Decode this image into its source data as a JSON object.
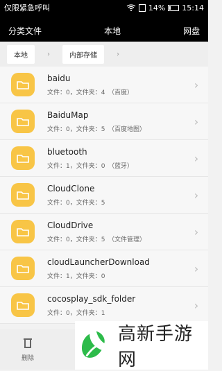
{
  "status": {
    "left_text": "仅限紧急呼叫",
    "battery_percent": "14%",
    "time": "15:14"
  },
  "tabs": [
    {
      "label": "分类文件"
    },
    {
      "label": "本地"
    },
    {
      "label": "网盘"
    }
  ],
  "breadcrumb": [
    {
      "label": "本地"
    },
    {
      "label": "内部存储"
    }
  ],
  "files": [
    {
      "name": "baidu",
      "meta": "文件：0，文件夹：4　（百度）"
    },
    {
      "name": "BaiduMap",
      "meta": "文件：0，文件夹：5　（百度地图）"
    },
    {
      "name": "bluetooth",
      "meta": "文件：1，文件夹：0　（蓝牙）"
    },
    {
      "name": "CloudClone",
      "meta": "文件：0，文件夹：5"
    },
    {
      "name": "CloudDrive",
      "meta": "文件：0，文件夹：5　（文件管理）"
    },
    {
      "name": "cloudLauncherDownload",
      "meta": "文件：1，文件夹：0"
    },
    {
      "name": "cocosplay_sdk_folder",
      "meta": "文件：0，文件夹：1"
    }
  ],
  "bottom": {
    "delete_label": "删除"
  },
  "watermark": {
    "text": "高新手游网"
  },
  "colors": {
    "folder": "#f8c546",
    "topbar": "#000000",
    "background": "#f2f2f2"
  },
  "icons": {
    "folder": "folder-icon",
    "chevron": "chevron-right-icon",
    "delete": "trash-icon",
    "wifi": "wifi-icon",
    "sim": "sim-icon",
    "battery": "battery-icon"
  }
}
